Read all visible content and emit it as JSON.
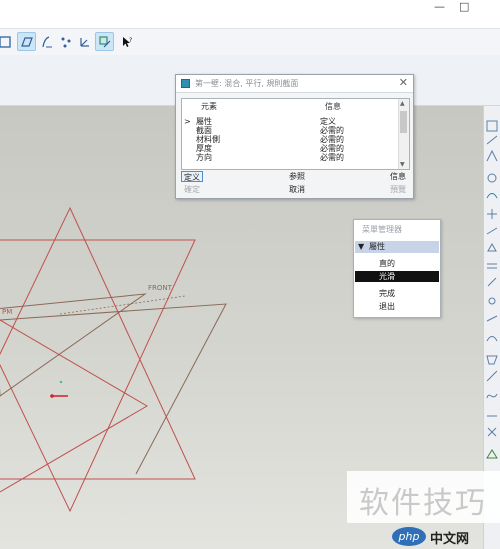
{
  "window": {
    "controls": [
      "—",
      "□"
    ]
  },
  "toolbar": {
    "icons": [
      "sketch-icon",
      "plane-icon",
      "datum-curve-icon",
      "datum-point-icon",
      "coord-system-icon",
      "analysis-icon",
      "help-cursor-icon"
    ]
  },
  "dialog": {
    "title": "第一壁: 混合, 平行, 規則截面",
    "columns": {
      "element": "元素",
      "info": "信息"
    },
    "rows": [
      {
        "element": "屬性",
        "info": "定义",
        "marker": ">"
      },
      {
        "element": "截面",
        "info": "必需的",
        "marker": ""
      },
      {
        "element": "材料側",
        "info": "必需的",
        "marker": ""
      },
      {
        "element": "厚度",
        "info": "必需的",
        "marker": ""
      },
      {
        "element": "方向",
        "info": "必需的",
        "marker": ""
      }
    ],
    "buttons": {
      "define": "定义",
      "refs": "参照",
      "info": "信息",
      "ok": "確定",
      "cancel": "取消",
      "preview": "預覽"
    }
  },
  "menu": {
    "title": "菜單管理器",
    "section": "屬性",
    "items": [
      {
        "label": "直的",
        "highlighted": false
      },
      {
        "label": "光滑",
        "highlighted": true
      },
      {
        "label": "完成",
        "highlighted": false
      },
      {
        "label": "退出",
        "highlighted": false
      }
    ]
  },
  "canvas": {
    "datum_label": "FRONT",
    "plane_label": "PM"
  },
  "watermark": {
    "text": "软件技巧",
    "logo": "php",
    "logo_text": "中文网"
  },
  "colors": {
    "highlight": "#111111",
    "menu_header": "#c7d4e7",
    "sketch_line": "#c0504d",
    "datum_line": "#8a6a5a"
  }
}
